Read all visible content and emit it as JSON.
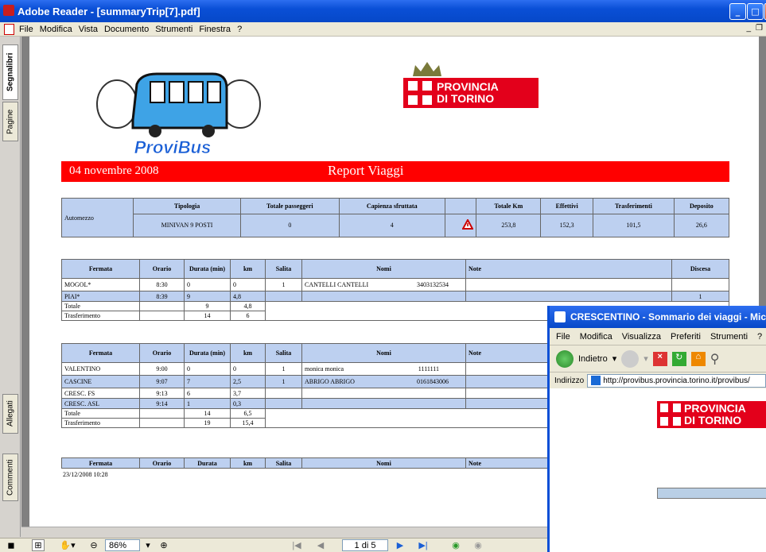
{
  "window": {
    "title": "Adobe Reader - [summaryTrip[7].pdf]",
    "min": "_",
    "max": "□",
    "close": "X"
  },
  "menu": [
    "File",
    "Modifica",
    "Vista",
    "Documento",
    "Strumenti",
    "Finestra",
    "?"
  ],
  "mdi_controls": {
    "min": "_",
    "restore": "❐"
  },
  "side_tabs": {
    "bookmarks": "Segnalibri",
    "pages": "Pagine",
    "attachments": "Allegati",
    "comments": "Commenti"
  },
  "logos": {
    "bus": "ProviBus",
    "provincia_line1": "PROVINCIA",
    "provincia_line2": "DI TORINO"
  },
  "header": {
    "date": "04 novembre 2008",
    "title": "Report Viaggi"
  },
  "summary": {
    "label": "Automezzo",
    "headers": [
      "Tipologia",
      "Totale passeggeri",
      "Capienza sfruttata",
      "",
      "Totale Km",
      "Effettivi",
      "Trasferimenti",
      "Deposito"
    ],
    "values": [
      "MINIVAN 9 POSTI",
      "0",
      "4",
      "",
      "253,8",
      "152,3",
      "101,5",
      "26,6"
    ]
  },
  "stop_headers": [
    "Fermata",
    "Orario",
    "Durata (min)",
    "km",
    "Salita",
    "Nomi",
    "Note",
    "Discesa"
  ],
  "trip1": {
    "rows": [
      {
        "fermata": "MOGOL*",
        "orario": "8:30",
        "durata": "0",
        "km": "0",
        "salita": "1",
        "nomi": "CANTELLI CANTELLI",
        "tel": "3403132534",
        "note": "",
        "discesa": ""
      },
      {
        "fermata": "PIAI*",
        "orario": "8:39",
        "durata": "9",
        "km": "4,8",
        "salita": "",
        "nomi": "",
        "tel": "",
        "note": "",
        "discesa": "1"
      }
    ],
    "totale": {
      "label": "Totale",
      "durata": "9",
      "km": "4,8"
    },
    "trasf": {
      "label": "Trasferimento",
      "durata": "14",
      "km": "6"
    }
  },
  "trip2": {
    "rows": [
      {
        "fermata": "VALENTINO",
        "orario": "9:00",
        "durata": "0",
        "km": "0",
        "salita": "1",
        "nomi": "monica monica",
        "tel": "1111111",
        "note": ""
      },
      {
        "fermata": "CASCINE",
        "orario": "9:07",
        "durata": "7",
        "km": "2,5",
        "salita": "1",
        "nomi": "ABRIGO ABRIGO",
        "tel": "0161843006",
        "note": ""
      },
      {
        "fermata": "CRESC. FS",
        "orario": "9:13",
        "durata": "6",
        "km": "3,7",
        "salita": "",
        "nomi": "",
        "tel": "",
        "note": ""
      },
      {
        "fermata": "CRESC. ASL",
        "orario": "9:14",
        "durata": "1",
        "km": "0,3",
        "salita": "",
        "nomi": "",
        "tel": "",
        "note": ""
      }
    ],
    "totale": {
      "label": "Totale",
      "durata": "14",
      "km": "6,5"
    },
    "trasf": {
      "label": "Trasferimento",
      "durata": "19",
      "km": "15,4"
    }
  },
  "trip3": {
    "headers": [
      "Fermata",
      "Orario",
      "Durata",
      "km",
      "Salita",
      "Nomi",
      "Note"
    ],
    "footer": "23/12/2008 10:28"
  },
  "toolbar": {
    "zoom": "86%",
    "page": "1 di 5"
  },
  "ie": {
    "title": "CRESCENTINO - Sommario dei viaggi - Micr",
    "menu": [
      "File",
      "Modifica",
      "Visualizza",
      "Preferiti",
      "Strumenti",
      "?"
    ],
    "back": "Indietro",
    "address_label": "Indirizzo",
    "url": "http://provibus.provincia.torino.it/provibus/"
  }
}
